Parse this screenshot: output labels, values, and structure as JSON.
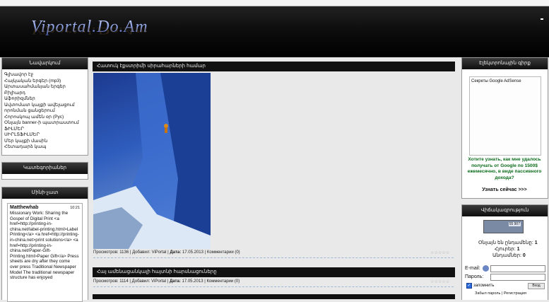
{
  "header": {
    "logo": "Viportal.Do.Am"
  },
  "left": {
    "nav_title": "Նավարկում",
    "nav_items": [
      "Գլխավոր էջ",
      "Հայկական երգեր (mp3)",
      "Արտասահմանյան երգեր",
      "Բիլիարդ",
      "Աֆորիզմներ",
      "Ավտոմատ կայքի ավելացում",
      "որոնման ցանցերում",
      "Հորոսկոպ ամեն օր (Рус)",
      "Օնլայն banner-ի պատրաստում",
      "ՖԻԼՄԵՐ",
      "ՍԻՐԼՏՖԻԼՄԵՐ",
      "Մեր կայքի մասին",
      "Հետադարձ կապ"
    ],
    "categories_title": "Կատեգորիաներ",
    "chat_title": "Մինի-չատ",
    "chat": {
      "user": "Matthewhab",
      "time": "10:21",
      "message": "Missionary Work: Sharing the Gospel of Digital Print <a href=http://printing-in-china.net/label-printing.html>Label Printing</a> <a href=http://printing-in-china.net>print solutions</a> <a href=http://printing-in-china.net/Paper-Gift-Printing.html>Paper Gift</a> Press sheets are dry after they come over press Traditional Newspaper Model The traditional newspaper structure has enjoyed"
    }
  },
  "posts": [
    {
      "title": "Հատուկ էքստրիմի սիրահարների համար",
      "views_label": "Просмотров:",
      "views": "1136",
      "added_label": "Добавил:",
      "author": "ViPortal",
      "date_label": "Дата:",
      "date": "17.05.2013",
      "comments_label": "Комментарии",
      "comments": "(0)"
    },
    {
      "title": "Հայ ամենացանկալի հայտնի հարսնացուները",
      "views_label": "Просмотров:",
      "views": "1114",
      "added_label": "Добавил:",
      "author": "ViPortal",
      "date_label": "Дата:",
      "date": "17.05.2013",
      "comments_label": "Комментарии",
      "comments": "(0)"
    }
  ],
  "right": {
    "ad_title": "Էլեկտրոնային գիրք",
    "ad_image_caption": "Секреты Google AdSense",
    "ad_text": "Хотите узнать, как мне удалось получать от Google по 1500$ ежемесячно, в виде пассивного дохода?",
    "ad_link": "Узнать сейчас >>>",
    "stats_title": "Վիճակագրություն",
    "counter_value": "55 907",
    "online_total_label": "Օնլայն են ընդամենը:",
    "online_total": "1",
    "guests_label": "Հյուրեր:",
    "guests": "1",
    "users_label": "Անդամներ:",
    "users": "0",
    "email_label": "E-mail:",
    "password_label": "Пароль:",
    "remember_label": "запомнить",
    "login_button": "Вход",
    "forgot_label": "Забыл пароль",
    "separator": "|",
    "register_label": "Регистрация"
  },
  "colors": {
    "bar_dark": "#111111",
    "ad_green": "#0a6b1a",
    "page_bg": "#e9e9e9"
  }
}
